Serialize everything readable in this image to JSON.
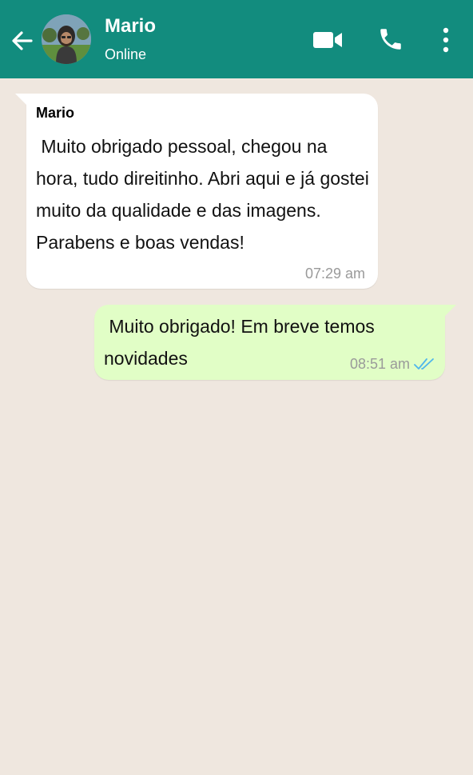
{
  "header": {
    "contact_name": "Mario",
    "status": "Online",
    "back_icon": "arrow-left",
    "video_icon": "video-camera",
    "call_icon": "phone",
    "more_icon": "vertical-dots",
    "bg_color": "#128c7e"
  },
  "messages": [
    {
      "direction": "incoming",
      "sender": "Mario",
      "text": " Muito obrigado pessoal, chegou na hora, tudo direitinho. Abri aqui e já gostei muito da qualidade e das imagens. Parabens e boas vendas!",
      "time": "07:29 am",
      "bubble_color": "#ffffff"
    },
    {
      "direction": "outgoing",
      "text": " Muito obrigado! Em breve temos novidades",
      "time": "08:51 am",
      "status_icon": "double-check-read",
      "bubble_color": "#e1fec6"
    }
  ],
  "colors": {
    "chat_background": "#efe7df",
    "read_ticks": "#4fb6ec"
  }
}
